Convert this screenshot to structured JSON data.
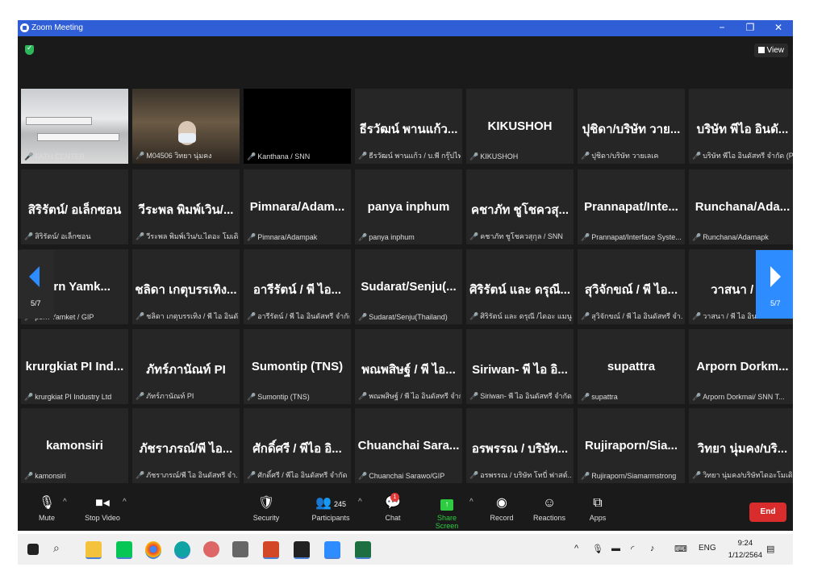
{
  "window": {
    "title": "Zoom Meeting",
    "min": "−",
    "max": "❐",
    "close": "✕"
  },
  "top": {
    "view_label": "View"
  },
  "tiles": [
    {
      "name": "",
      "label": "FATH CENTER",
      "type": "cam1"
    },
    {
      "name": "",
      "label": "M04506 วิทยา นุ่มคง",
      "type": "cam2"
    },
    {
      "name": "",
      "label": "Kanthana / SNN",
      "type": "black"
    },
    {
      "name": "ธีรวัฒน์ พานแก้ว...",
      "label": "ธีรวัฒน์ พานแก้ว / บ.พี กรุ๊ปไท..."
    },
    {
      "name": "KIKUSHOH",
      "label": "KIKUSHOH"
    },
    {
      "name": "ปุชิดา/บริษัท วาย...",
      "label": "ปุชิดา/บริษัท วายเลเค"
    },
    {
      "name": "บริษัท พีไอ อินดั...",
      "label": "บริษัท พีไอ อินดัสทรี จำกัด (P..."
    },
    {
      "name": "สิริรัตน์/ อเล็กซอน",
      "label": "สิริรัตน์/ อเล็กซอน"
    },
    {
      "name": "วีระพล พิมพ์เวิน/...",
      "label": "วีระพล พิมพ์เวิน/บ.ไดอะ โมเดิ..."
    },
    {
      "name": "Pimnara/Adam...",
      "label": "Pimnara/Adampak"
    },
    {
      "name": "panya inphum",
      "label": "panya inphum"
    },
    {
      "name": "คชาภัท ชูโชควสุ...",
      "label": "คชาภัท ชูโชควสุกุล / SNN"
    },
    {
      "name": "Prannapat/Inte...",
      "label": "Prannapat/Interface Syste..."
    },
    {
      "name": "Runchana/Ada...",
      "label": "Runchana/Adamapk"
    },
    {
      "name": "porn Yamk...",
      "label": "porn Yamket / GIP"
    },
    {
      "name": "ชลิดา เกตุบรรเทิง...",
      "label": "ชลิดา เกตุบรรเทิง / พี ไอ อินดั..."
    },
    {
      "name": "อารีรัตน์ / พี ไอ...",
      "label": "อารีรัตน์ / พี ไอ อินดัสทรี จำกัด"
    },
    {
      "name": "Sudarat/Senju(...",
      "label": "Sudarat/Senju(Thailand)"
    },
    {
      "name": "ศิริรัตน์ และ ดรุณี...",
      "label": "ศิริรัตน์ และ ดรุณี /ไดอะ แมนู..."
    },
    {
      "name": "สุวิจักขณ์ / พี ไอ...",
      "label": "สุวิจักขณ์ / พี ไอ อินดัสทรี จำ..."
    },
    {
      "name": "วาสนา / พี ไ",
      "label": "วาสนา / พี ไอ อินดัส"
    },
    {
      "name": "krurgkiat PI Ind...",
      "label": "krurgkiat PI Industry Ltd"
    },
    {
      "name": "ภัทร์ภานัณท์ PI",
      "label": "ภัทร์ภานัณท์ PI"
    },
    {
      "name": "Sumontip (TNS)",
      "label": "Sumontip (TNS)"
    },
    {
      "name": "พณพสิษฐ์ / พี ไอ...",
      "label": "พณพสิษฐ์ / พี ไอ อินดัสทรี จำกัด"
    },
    {
      "name": "Siriwan- พี ไอ อิ...",
      "label": "Siriwan- พี ไอ อินดัสทรี จำกัด"
    },
    {
      "name": "supattra",
      "label": "supattra"
    },
    {
      "name": "Arporn Dorkm...",
      "label": "Arporn Dorkmai/ SNN T..."
    },
    {
      "name": "kamonsiri",
      "label": "kamonsiri"
    },
    {
      "name": "ภัชราภรณ์/พี ไอ...",
      "label": "ภัชราภรณ์/พี ไอ อินดัสทรี จำ..."
    },
    {
      "name": "ศักดิ์ศรี / พีไอ อิ...",
      "label": "ศักดิ์ศรี / พีไอ อินดัสทรี จำกัด"
    },
    {
      "name": "Chuanchai Sara...",
      "label": "Chuanchai Sarawo/GIP"
    },
    {
      "name": "อรพรรณ / บริษัท...",
      "label": "อรพรรณ / บริษัท โทบี่ ฟาสต์..."
    },
    {
      "name": "Rujiraporn/Sia...",
      "label": "Rujiraporn/Siamarmstrong"
    },
    {
      "name": "วิทยา นุ่มคง/บริ...",
      "label": "วิทยา นุ่มคง/บริษัทไดอะโมเดิร์..."
    }
  ],
  "pager": {
    "left": "5/7",
    "right": "5/7"
  },
  "toolbar": {
    "mute": "Mute",
    "stop_video": "Stop Video",
    "security": "Security",
    "participants": "Participants",
    "participants_count": "245",
    "chat": "Chat",
    "chat_badge": "1",
    "share": "Share Screen",
    "record": "Record",
    "reactions": "Reactions",
    "apps": "Apps",
    "end": "End"
  },
  "taskbar": {
    "lang": "ENG",
    "time": "9:24",
    "date": "1/12/2564"
  },
  "colors": {
    "share_green": "#2ecc40",
    "zoom_blue": "#2d8cff",
    "end_red": "#d92d2d"
  }
}
